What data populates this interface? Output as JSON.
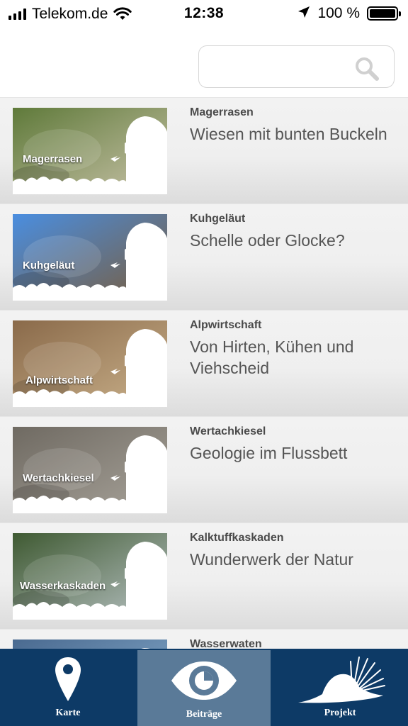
{
  "status_bar": {
    "carrier": "Telekom.de",
    "time": "12:38",
    "battery_percent": "100 %",
    "battery_level": 1.0,
    "icons": [
      "signal-icon",
      "wifi-icon",
      "location-arrow-icon",
      "battery-icon"
    ]
  },
  "search": {
    "value": "",
    "placeholder": "",
    "icon": "search-icon"
  },
  "items": [
    {
      "thumb_label": "Magerrasen",
      "category": "Magerrasen",
      "title": "Wiesen mit bunten Buckeln",
      "colors": [
        "#5f7a3a",
        "#c8c2a8"
      ]
    },
    {
      "thumb_label": "Kuhgeläut",
      "category": "Kuhgeläut",
      "title": "Schelle oder Glocke?",
      "colors": [
        "#4a8ee0",
        "#7a5c3a"
      ]
    },
    {
      "thumb_label": "Alpwirtschaft",
      "category": "Alpwirtschaft",
      "title": "Von Hirten, Kühen und Viehscheid",
      "colors": [
        "#8a6a4a",
        "#c9b08a"
      ]
    },
    {
      "thumb_label": "Wertachkiesel",
      "category": "Wertachkiesel",
      "title": "Geologie im Flussbett",
      "colors": [
        "#6f6a62",
        "#a8a39a"
      ]
    },
    {
      "thumb_label": "Wasserkaskaden",
      "category": "Kalktuffkaskaden",
      "title": "Wunderwerk der Natur",
      "colors": [
        "#3f5a32",
        "#b8c2c4"
      ]
    },
    {
      "thumb_label": "",
      "category": "Wasserwaten",
      "title": "",
      "colors": [
        "#4a6a90",
        "#8ab0d0"
      ]
    }
  ],
  "tabs": [
    {
      "label": "Karte",
      "icon": "map-pin-icon",
      "active": false
    },
    {
      "label": "Beiträge",
      "icon": "eye-icon",
      "active": true
    },
    {
      "label": "Projekt",
      "icon": "hat-icon",
      "active": false
    }
  ]
}
